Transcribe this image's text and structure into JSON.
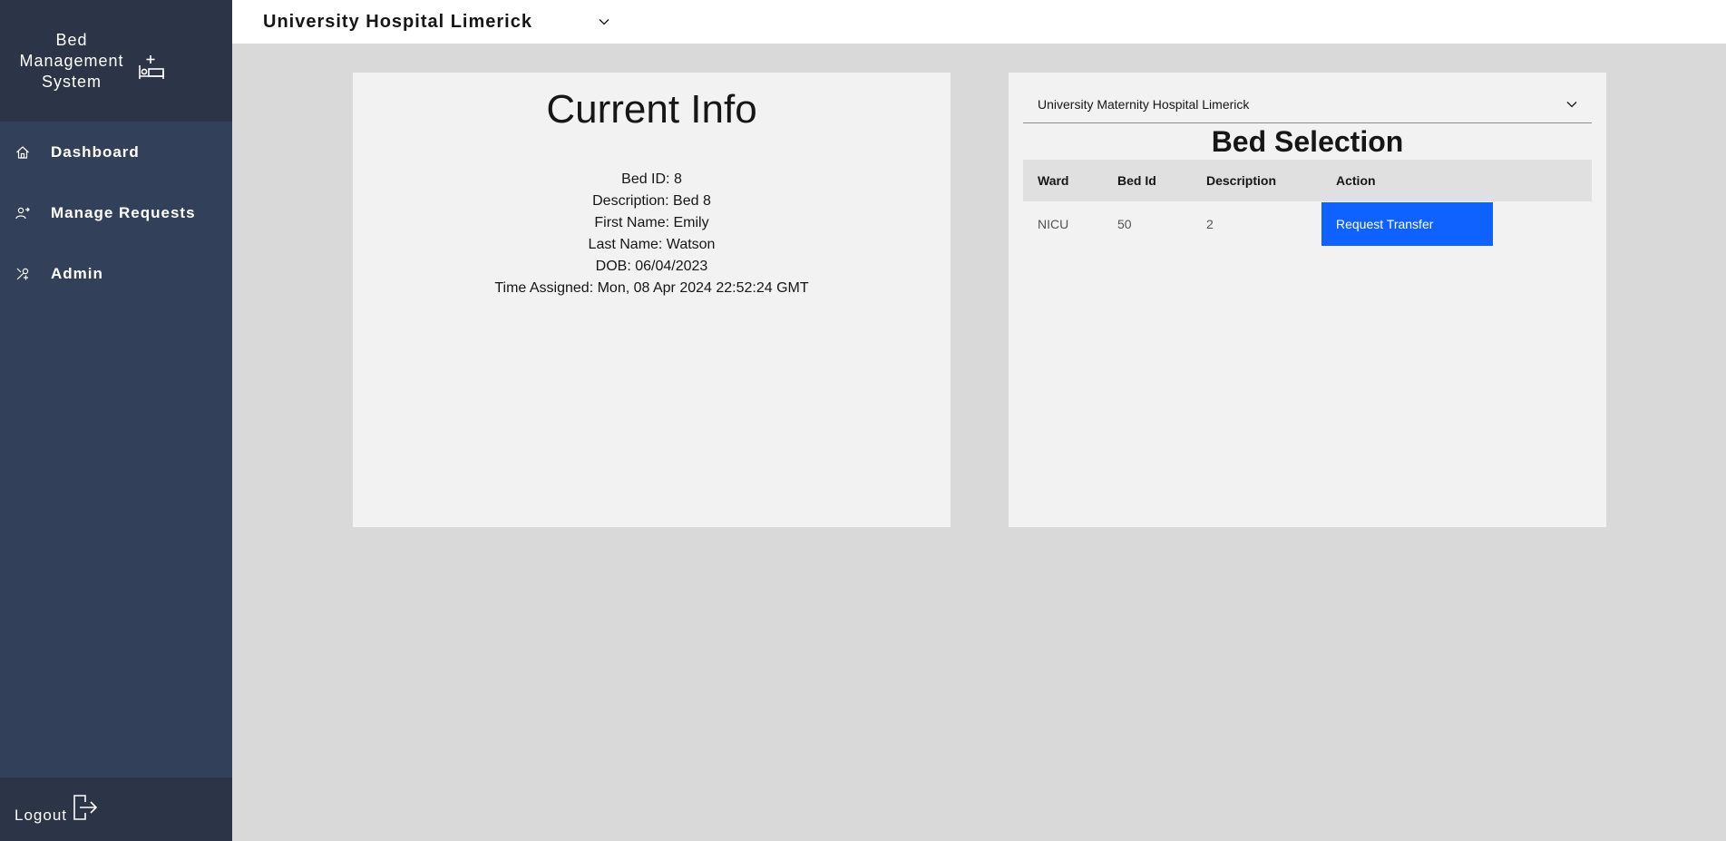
{
  "sidebar": {
    "brand": [
      "Bed",
      "Management",
      "System"
    ],
    "items": [
      {
        "label": "Dashboard",
        "icon": "home-icon"
      },
      {
        "label": "Manage Requests",
        "icon": "user-requests-icon"
      },
      {
        "label": "Admin",
        "icon": "admin-tools-icon"
      }
    ],
    "logout_label": "Logout"
  },
  "header": {
    "hospital": "University Hospital Limerick"
  },
  "current_info": {
    "title": "Current Info",
    "lines": [
      "Bed ID: 8",
      "Description: Bed 8",
      "First Name: Emily",
      "Last Name: Watson",
      "DOB: 06/04/2023",
      "Time Assigned: Mon, 08 Apr 2024 22:52:24 GMT"
    ]
  },
  "bed_selection": {
    "hospital": "University Maternity Hospital Limerick",
    "title": "Bed Selection",
    "columns": [
      "Ward",
      "Bed Id",
      "Description",
      "Action"
    ],
    "rows": [
      {
        "ward": "NICU",
        "bed_id": "50",
        "description": "2",
        "action": "Request Transfer"
      }
    ]
  },
  "colors": {
    "sidebar": "#324059",
    "sidebar_dark": "#2b3547",
    "primary_button": "#0f62fe",
    "background": "#d9d9d9"
  }
}
